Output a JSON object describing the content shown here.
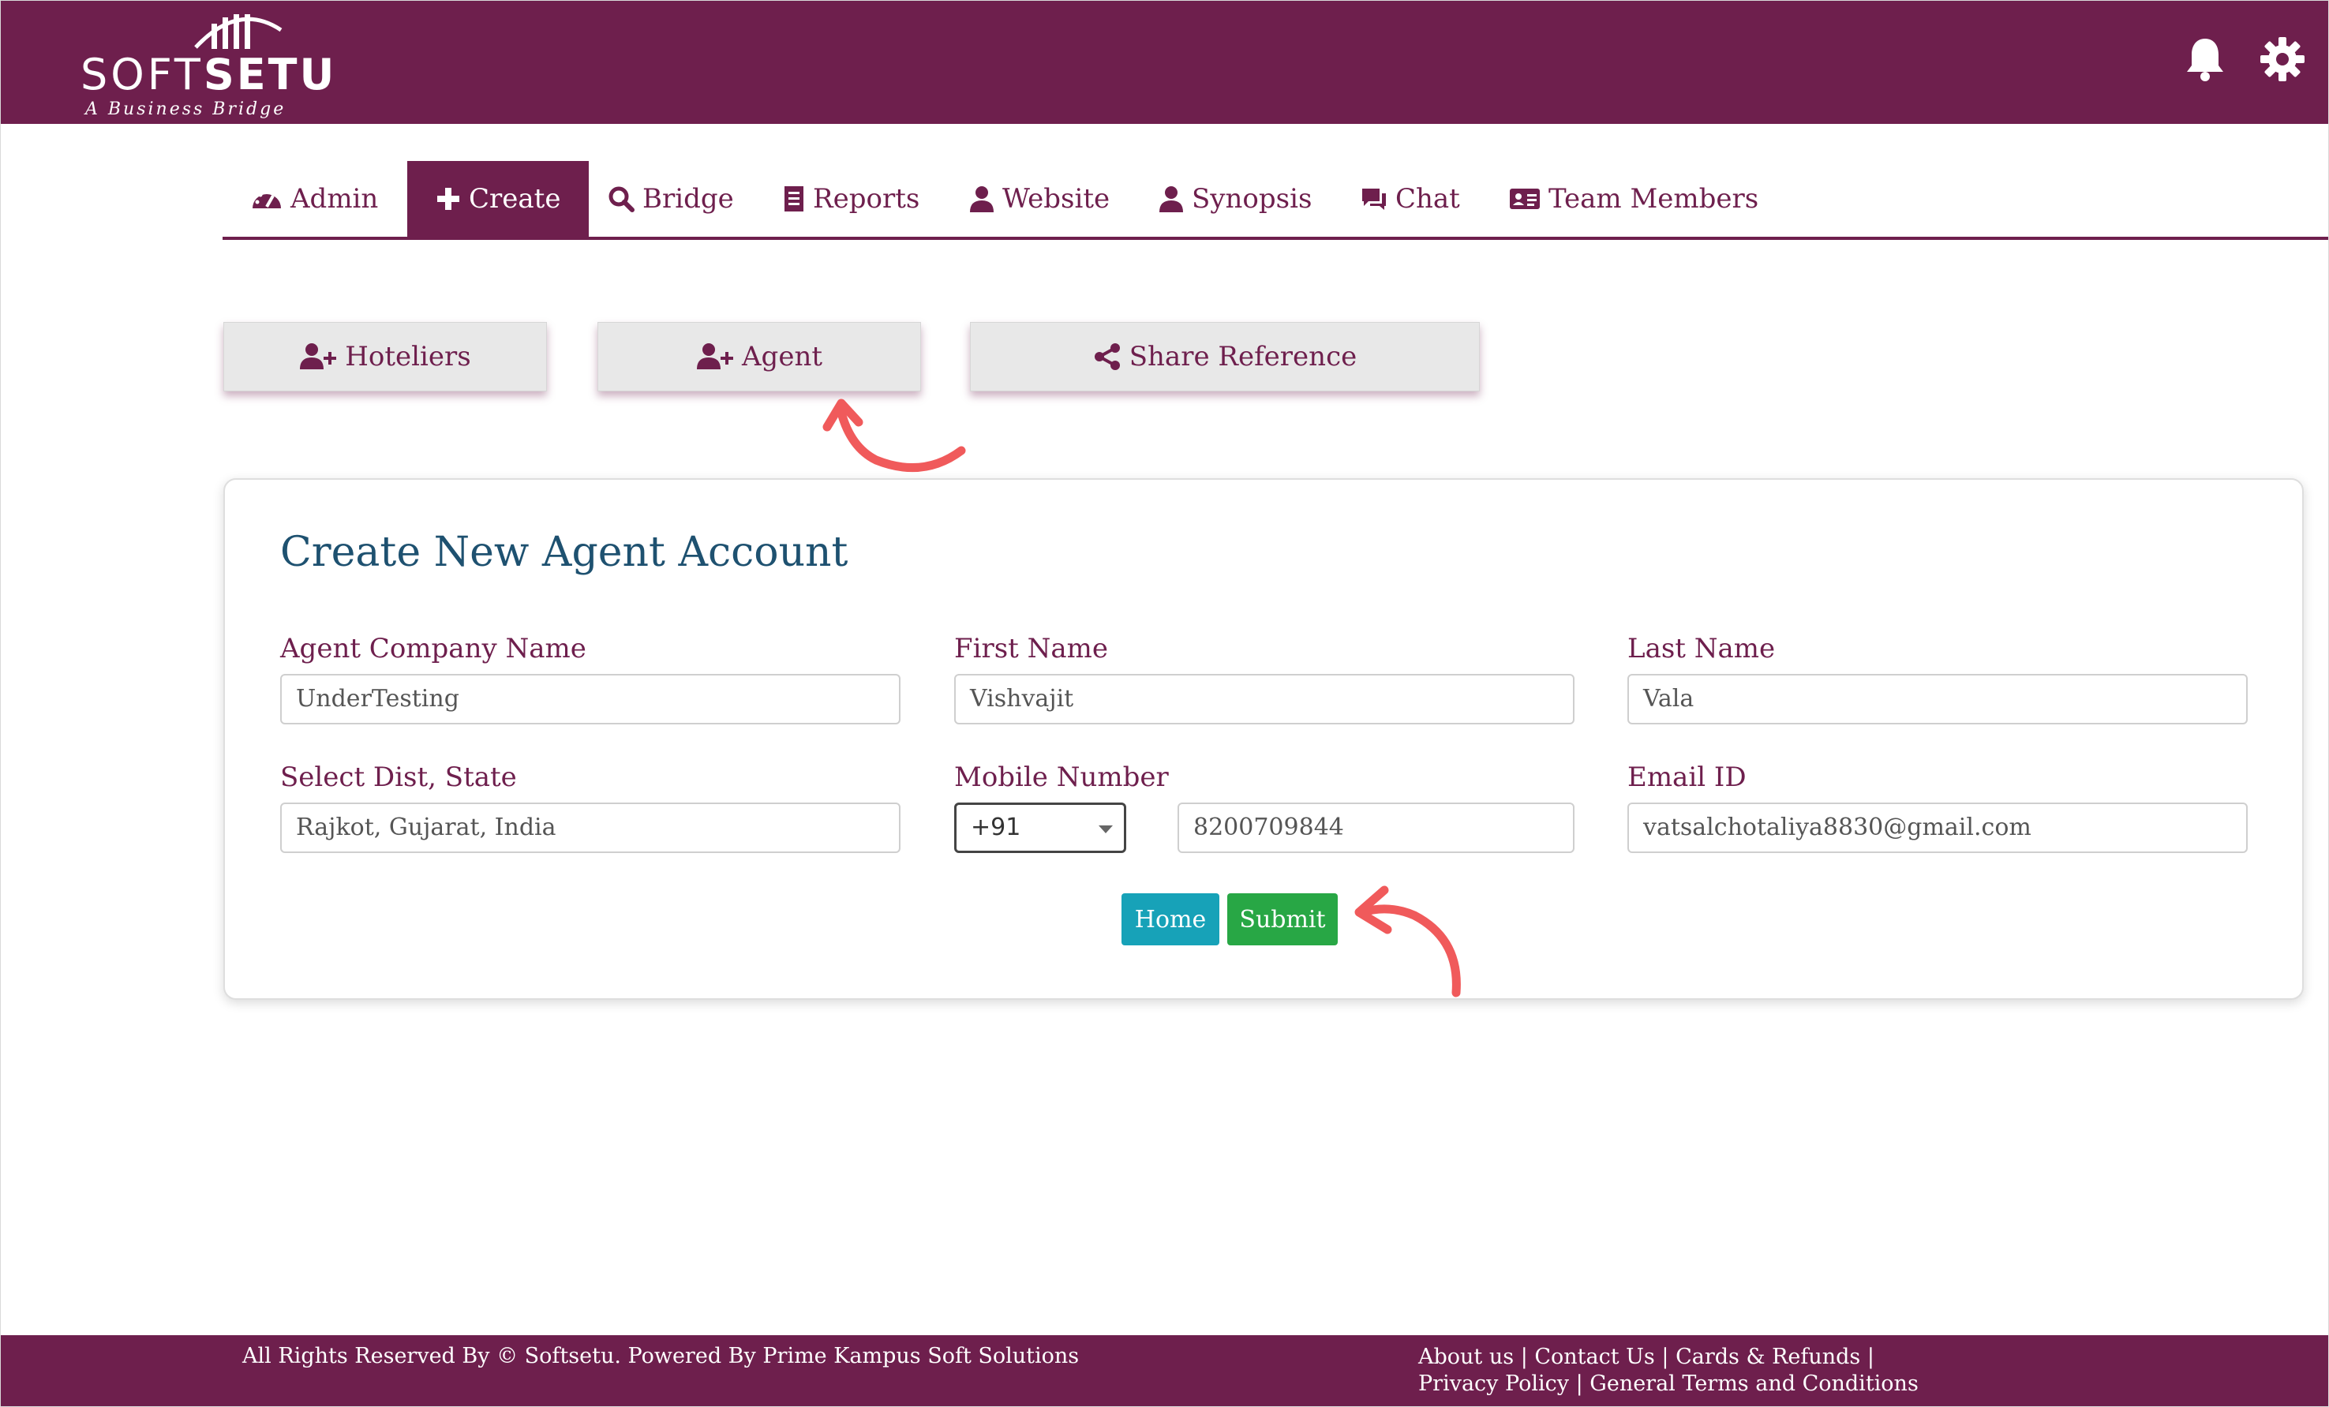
{
  "brand": {
    "name_light": "SOFT",
    "name_bold": "SETU",
    "tagline": "A Business Bridge"
  },
  "header": {
    "icons": [
      "bell-icon",
      "gear-icon"
    ]
  },
  "nav": {
    "tabs": [
      {
        "label": "Admin",
        "icon": "dashboard-icon"
      },
      {
        "label": "Create",
        "icon": "plus-icon",
        "active": true
      },
      {
        "label": "Bridge",
        "icon": "search-icon"
      },
      {
        "label": "Reports",
        "icon": "receipt-icon"
      },
      {
        "label": "Website",
        "icon": "user-icon"
      },
      {
        "label": "Synopsis",
        "icon": "user-icon"
      },
      {
        "label": "Chat",
        "icon": "comments-icon"
      },
      {
        "label": "Team Members",
        "icon": "id-card-icon"
      }
    ]
  },
  "sub_buttons": [
    {
      "label": "Hoteliers",
      "icon": "user-plus-icon"
    },
    {
      "label": "Agent",
      "icon": "user-plus-icon"
    },
    {
      "label": "Share Reference",
      "icon": "share-icon"
    }
  ],
  "form": {
    "title": "Create New Agent Account",
    "company_label": "Agent Company Name",
    "company_value": "UnderTesting",
    "first_name_label": "First Name",
    "first_name_value": "Vishvajit",
    "last_name_label": "Last Name",
    "last_name_value": "Vala",
    "district_label": "Select Dist, State",
    "district_value": "Rajkot, Gujarat, India",
    "mobile_label": "Mobile Number",
    "country_code": "+91",
    "mobile_value": "8200709844",
    "email_label": "Email ID",
    "email_value": "vatsalchotaliya8830@gmail.com",
    "home_label": "Home",
    "submit_label": "Submit"
  },
  "footer": {
    "copyright": "All Rights Reserved By © Softsetu. Powered By Prime Kampus Soft Solutions",
    "links": [
      "About us",
      "Contact Us",
      "Cards & Refunds",
      "Privacy Policy",
      "General Terms and Conditions"
    ]
  },
  "colors": {
    "brand": "#6e1f4d",
    "title": "#1e5170",
    "home_button": "#17a2b8",
    "submit_button": "#28a745",
    "annotation_arrow": "#f05a5b"
  }
}
